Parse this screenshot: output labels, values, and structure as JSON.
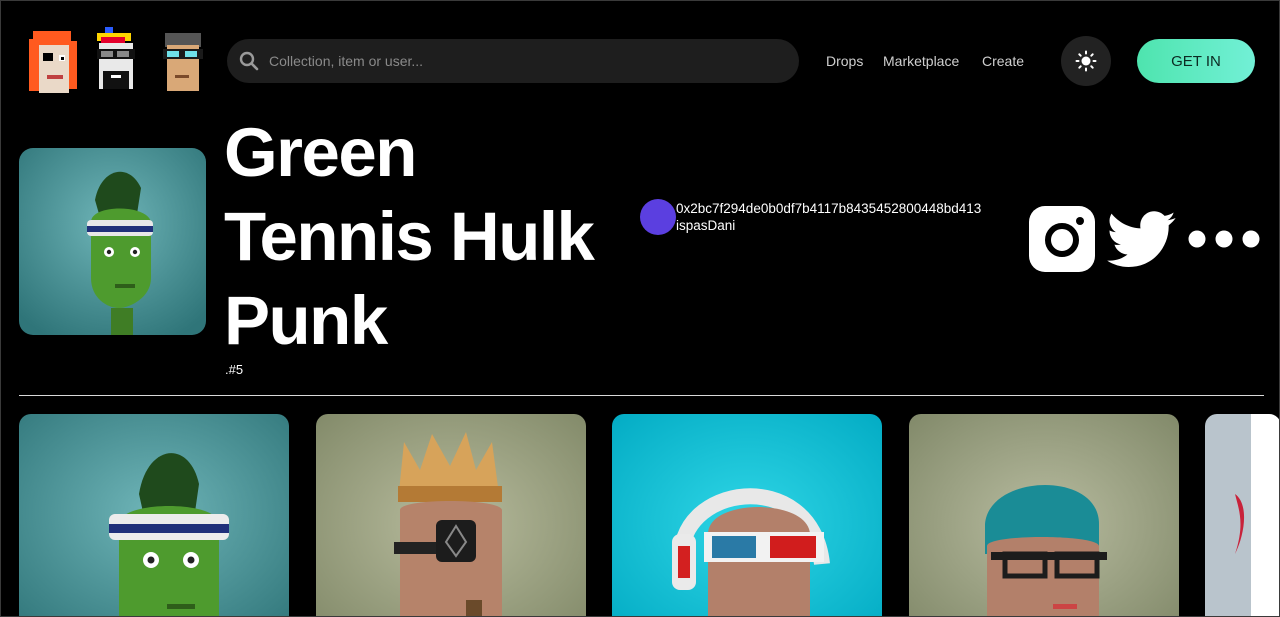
{
  "header": {
    "logo_alt": "pixel punks logo",
    "search": {
      "placeholder": "Collection, item or user...",
      "value": ""
    },
    "nav": [
      {
        "label": "Drops"
      },
      {
        "label": "Marketplace"
      },
      {
        "label": "Create"
      }
    ],
    "theme_icon": "sun-icon",
    "cta_label": "GET IN",
    "cta_color": "#5EEBB8"
  },
  "item": {
    "title_lines": [
      "Green",
      "Tennis Hulk",
      "Punk"
    ],
    "edition": ".#5",
    "owner_address": "0x2bc7f294de0b0df7b4117b8435452800448bd413",
    "owner_name": "ispasDani",
    "owner_avatar_color": "#5B3FE0"
  },
  "social": [
    {
      "icon": "instagram-icon"
    },
    {
      "icon": "twitter-icon"
    },
    {
      "icon": "more-icon"
    }
  ],
  "gallery": [
    {
      "name": "green punk with headband"
    },
    {
      "name": "crowned punk with eyepatch"
    },
    {
      "name": "punk with headphones and 3d glasses"
    },
    {
      "name": "punk with beanie and glasses"
    },
    {
      "name": "partial punk card"
    }
  ]
}
